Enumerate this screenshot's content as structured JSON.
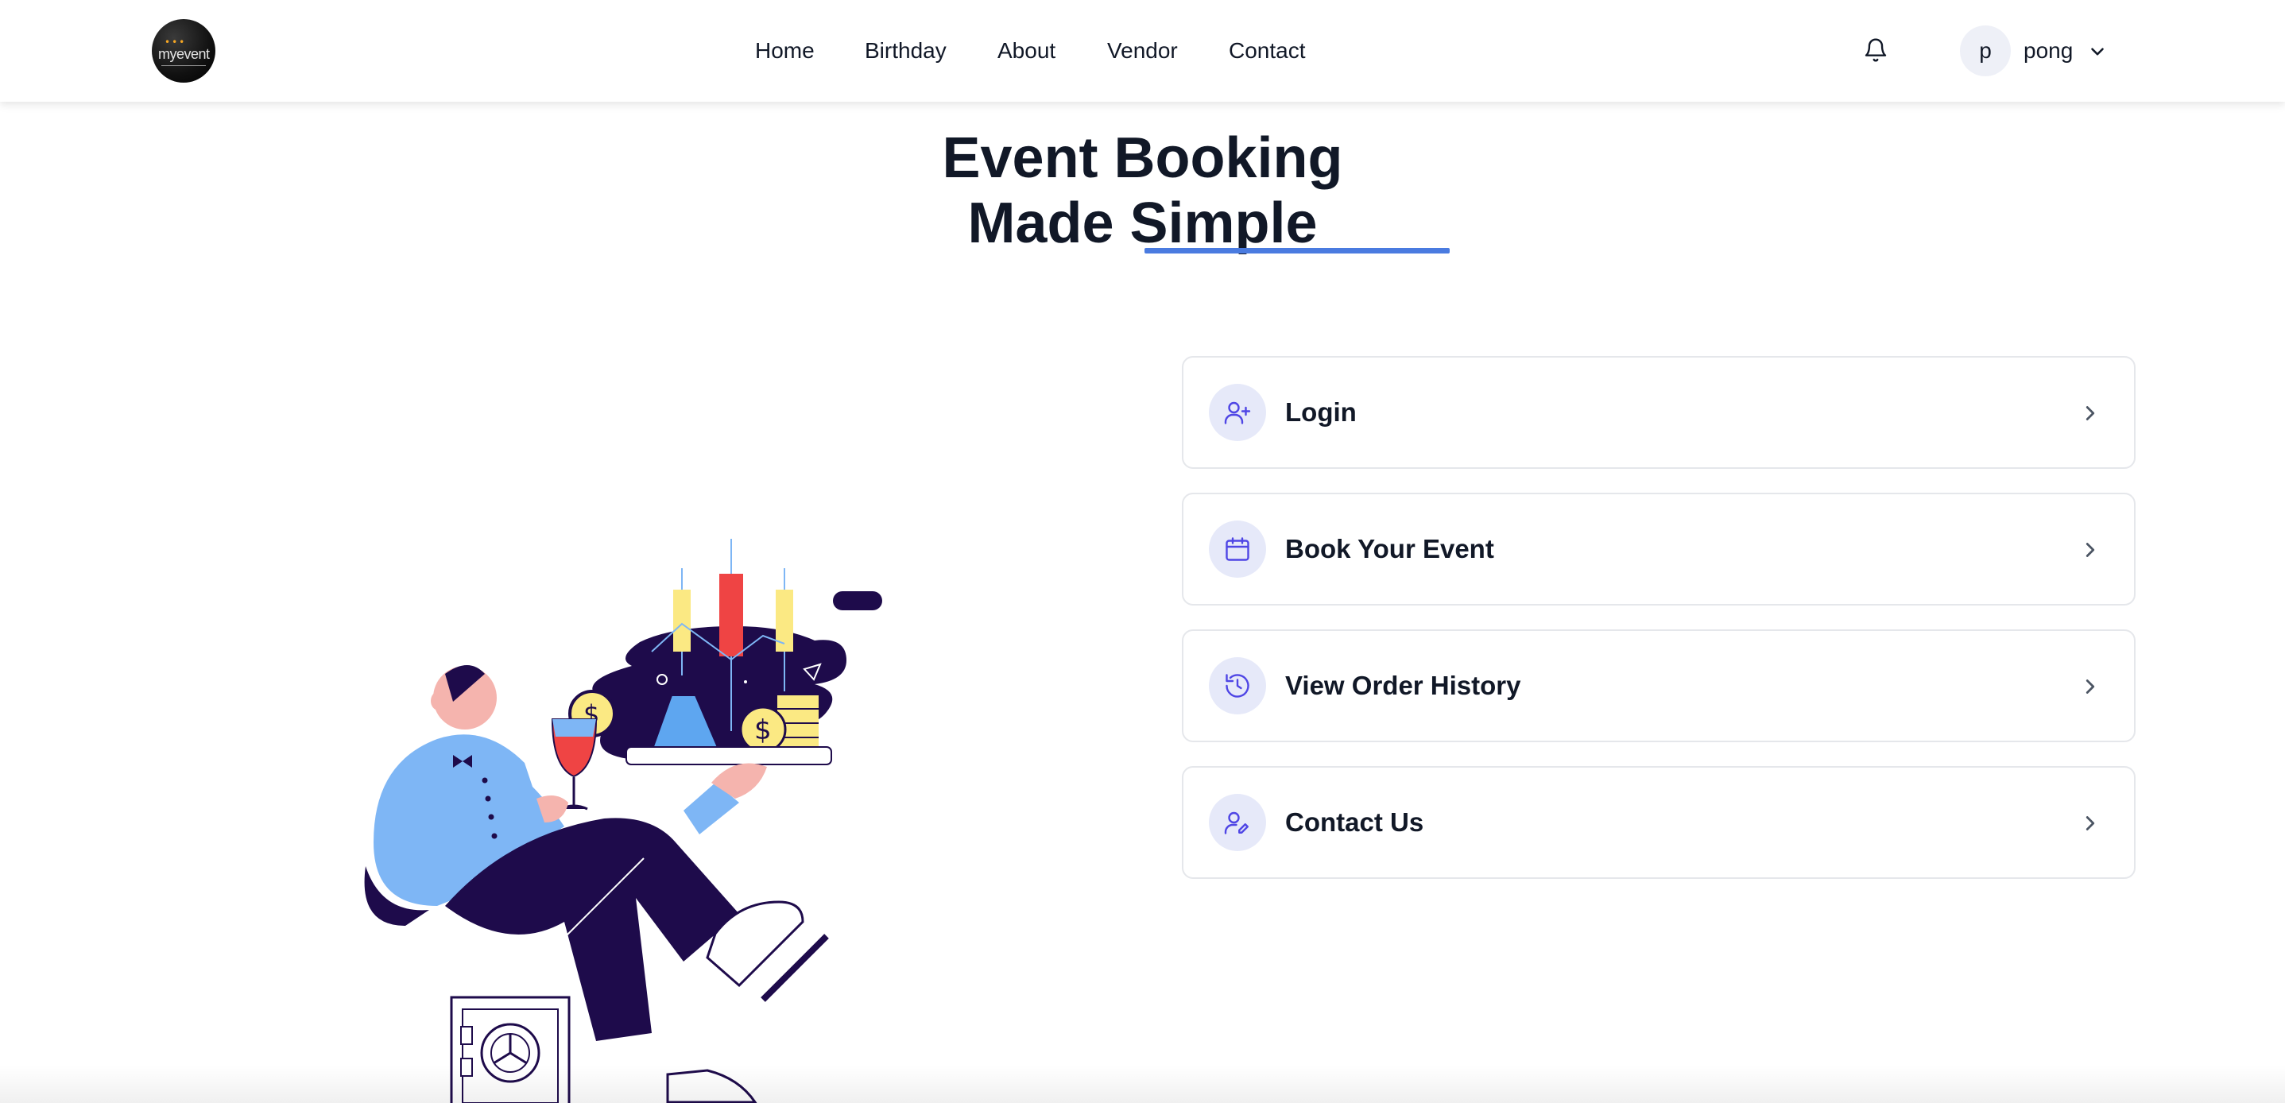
{
  "header": {
    "logo": {
      "alt": "myevent",
      "text_prefix": "my",
      "text_suffix": "event"
    },
    "nav": [
      {
        "label": "Home"
      },
      {
        "label": "Birthday"
      },
      {
        "label": "About"
      },
      {
        "label": "Vendor"
      },
      {
        "label": "Contact"
      }
    ],
    "notification_icon": "bell-icon",
    "user": {
      "avatar_initial": "p",
      "name": "pong",
      "dropdown_icon": "chevron-down-icon"
    }
  },
  "hero": {
    "title_line1": "Event Booking",
    "title_line2": "Made Simple",
    "accent_color": "#4a7be0"
  },
  "menu": [
    {
      "label": "Login",
      "icon": "user-plus-icon"
    },
    {
      "label": "Book Your Event",
      "icon": "calendar-icon"
    },
    {
      "label": "View Order History",
      "icon": "history-icon"
    },
    {
      "label": "Contact Us",
      "icon": "user-edit-icon"
    }
  ],
  "colors": {
    "text": "#111827",
    "icon_accent": "#4f46e5",
    "icon_bg": "#e6e9f9",
    "card_border": "#e5e7eb"
  }
}
